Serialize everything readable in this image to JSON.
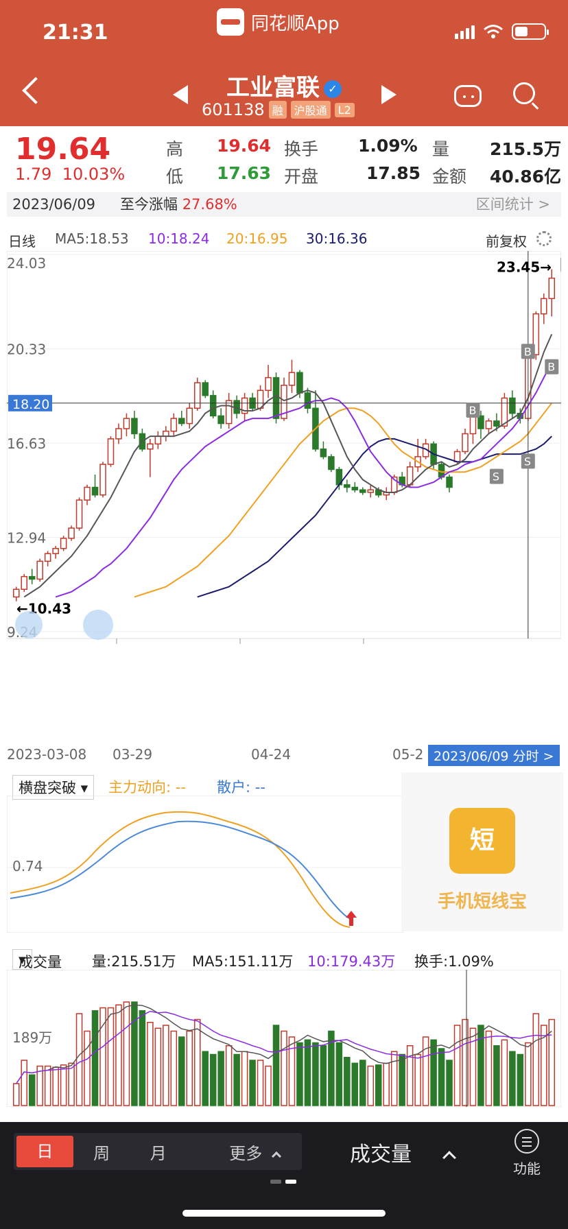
{
  "status_bar": {
    "time": "21:31",
    "app_name": "同花顺App"
  },
  "header": {
    "stock_name": "工业富联",
    "stock_code": "601138",
    "tags": [
      "融",
      "沪股通",
      "L2"
    ],
    "icons": [
      "back-icon",
      "prev-stock-icon",
      "next-stock-icon",
      "robot-icon",
      "search-icon",
      "verified-icon"
    ]
  },
  "quote": {
    "price": "19.64",
    "change": "1.79",
    "change_pct": "10.03%",
    "high_label": "高",
    "high": "19.64",
    "low_label": "低",
    "low": "17.63",
    "turnover_label": "换手",
    "turnover": "1.09%",
    "open_label": "开盘",
    "open": "17.85",
    "volume_label": "量",
    "volume": "215.5万",
    "amount_label": "金额",
    "amount": "40.86亿"
  },
  "date_bar": {
    "date": "2023/06/09",
    "gain_label": "至今涨幅",
    "gain": "27.68%",
    "stats": "区间统计 >"
  },
  "ma_row": {
    "period": "日线",
    "ma5": "MA5:18.53",
    "ma10": "10:18.24",
    "ma20": "20:16.95",
    "ma30": "30:16.36",
    "adjust": "前复权"
  },
  "kline": {
    "y_ticks": [
      "24.03",
      "20.33",
      "16.63",
      "12.94",
      "9.24"
    ],
    "crosshair_price": "18.20",
    "max_label": "23.45→",
    "min_label": "←10.43",
    "x_ticks": [
      "2023-03-08",
      "03-29",
      "04-24",
      "05-2"
    ],
    "crosshair_date": "2023/06/09 分时 >"
  },
  "panel2": {
    "indicator": "横盘突破",
    "main_force": "主力动向: --",
    "retail": "散户: --",
    "y_tick": "0.74",
    "promo_icon_text": "短",
    "promo_text": "手机短线宝"
  },
  "panel3": {
    "indicator": "成交量",
    "volume": "量:215.51万",
    "ma5": "MA5:151.11万",
    "ma10": "10:179.43万",
    "turnover": "换手:1.09%",
    "y_tick": "189万"
  },
  "bottom_bar": {
    "tabs": [
      "日",
      "周",
      "月",
      "更多"
    ],
    "indicator_select": "成交量",
    "func_label": "功能"
  },
  "colors": {
    "brand": "#d0543a",
    "up": "#e02e2e",
    "down": "#2d9b37",
    "ma5": "#555555",
    "ma10": "#8a2be2",
    "ma20": "#f0a020",
    "ma30": "#1a1a6e",
    "crosshair": "#3a78d6"
  },
  "chart_data": {
    "type": "candlestick",
    "price_axis": [
      24.03,
      20.33,
      16.63,
      12.94,
      9.24
    ],
    "ohlc": [
      [
        10.6,
        11.0,
        10.43,
        10.9
      ],
      [
        10.9,
        11.5,
        10.8,
        11.4
      ],
      [
        11.4,
        11.7,
        11.1,
        11.3
      ],
      [
        11.3,
        12.1,
        11.2,
        12.0
      ],
      [
        12.0,
        12.4,
        11.8,
        12.3
      ],
      [
        12.3,
        12.6,
        12.1,
        12.5
      ],
      [
        12.5,
        13.0,
        12.4,
        12.9
      ],
      [
        12.9,
        13.4,
        12.8,
        13.3
      ],
      [
        13.3,
        14.5,
        13.2,
        14.4
      ],
      [
        14.4,
        15.0,
        14.2,
        14.9
      ],
      [
        14.9,
        15.4,
        14.5,
        14.6
      ],
      [
        14.6,
        15.9,
        14.5,
        15.8
      ],
      [
        15.8,
        16.9,
        15.7,
        16.8
      ],
      [
        16.8,
        17.4,
        16.6,
        17.2
      ],
      [
        17.2,
        17.8,
        16.9,
        17.6
      ],
      [
        17.6,
        17.9,
        16.8,
        17.0
      ],
      [
        17.0,
        17.2,
        16.3,
        16.4
      ],
      [
        16.4,
        16.8,
        15.3,
        16.6
      ],
      [
        16.6,
        17.1,
        16.4,
        16.9
      ],
      [
        16.9,
        17.3,
        16.7,
        17.1
      ],
      [
        17.1,
        17.8,
        16.9,
        17.6
      ],
      [
        17.6,
        17.9,
        17.3,
        17.4
      ],
      [
        17.4,
        18.2,
        17.2,
        18.0
      ],
      [
        18.0,
        19.2,
        17.9,
        19.0
      ],
      [
        19.0,
        19.1,
        18.4,
        18.5
      ],
      [
        18.5,
        18.7,
        17.6,
        17.7
      ],
      [
        17.7,
        18.0,
        17.2,
        17.4
      ],
      [
        17.4,
        18.6,
        17.2,
        18.3
      ],
      [
        18.3,
        18.5,
        17.6,
        17.8
      ],
      [
        17.8,
        18.6,
        17.5,
        18.4
      ],
      [
        18.4,
        18.6,
        17.9,
        18.0
      ],
      [
        18.0,
        18.9,
        17.9,
        18.7
      ],
      [
        18.7,
        19.7,
        18.4,
        19.2
      ],
      [
        19.2,
        19.4,
        17.4,
        17.6
      ],
      [
        17.6,
        19.2,
        17.5,
        18.9
      ],
      [
        18.9,
        19.9,
        18.6,
        19.4
      ],
      [
        19.4,
        19.5,
        18.4,
        18.6
      ],
      [
        18.6,
        18.8,
        17.8,
        18.0
      ],
      [
        18.0,
        18.7,
        16.3,
        16.4
      ],
      [
        16.4,
        16.7,
        16.0,
        16.1
      ],
      [
        16.1,
        16.2,
        15.5,
        15.6
      ],
      [
        15.6,
        15.7,
        14.8,
        15.0
      ],
      [
        15.0,
        15.2,
        14.7,
        14.9
      ],
      [
        14.9,
        15.1,
        14.7,
        14.8
      ],
      [
        14.8,
        14.9,
        14.6,
        14.7
      ],
      [
        14.7,
        15.0,
        14.5,
        14.8
      ],
      [
        14.8,
        14.9,
        14.5,
        14.6
      ],
      [
        14.6,
        14.9,
        14.4,
        14.7
      ],
      [
        14.7,
        15.4,
        14.6,
        15.3
      ],
      [
        15.3,
        15.5,
        14.9,
        15.0
      ],
      [
        15.0,
        15.9,
        14.9,
        15.7
      ],
      [
        15.7,
        16.8,
        15.5,
        16.1
      ],
      [
        16.1,
        16.8,
        16.0,
        16.6
      ],
      [
        16.6,
        16.7,
        15.6,
        15.8
      ],
      [
        15.8,
        15.9,
        15.2,
        15.3
      ],
      [
        15.3,
        15.4,
        14.7,
        14.9
      ],
      [
        15.9,
        16.4,
        15.8,
        16.3
      ],
      [
        16.3,
        17.2,
        16.2,
        17.0
      ],
      [
        17.0,
        17.8,
        16.6,
        17.7
      ],
      [
        17.7,
        17.9,
        16.8,
        17.2
      ],
      [
        17.2,
        17.6,
        17.0,
        17.5
      ],
      [
        17.5,
        17.8,
        17.1,
        17.3
      ],
      [
        17.3,
        18.6,
        17.2,
        18.4
      ],
      [
        18.4,
        18.7,
        17.6,
        17.8
      ],
      [
        17.8,
        18.0,
        17.4,
        17.6
      ],
      [
        17.6,
        20.3,
        17.5,
        20.1
      ],
      [
        20.1,
        21.8,
        19.9,
        21.7
      ],
      [
        21.7,
        22.5,
        21.3,
        22.3
      ],
      [
        22.3,
        23.45,
        21.6,
        23.1
      ]
    ],
    "ma5": [
      10.6,
      10.8,
      11.0,
      11.3,
      11.6,
      11.9,
      12.2,
      12.6,
      13.0,
      13.5,
      14.0,
      14.5,
      15.1,
      15.7,
      16.3,
      16.7,
      16.9,
      16.9,
      16.9,
      16.9,
      17.0,
      17.1,
      17.4,
      17.8,
      18.0,
      18.1,
      18.1,
      18.0,
      17.9,
      17.9,
      18.0,
      18.3,
      18.5,
      18.3,
      18.4,
      18.6,
      18.7,
      18.6,
      18.2,
      17.5,
      16.8,
      16.1,
      15.6,
      15.2,
      15.0,
      14.8,
      14.7,
      14.7,
      14.8,
      15.0,
      15.3,
      15.6,
      15.8,
      15.9,
      15.7,
      15.8,
      16.0,
      16.4,
      16.7,
      17.0,
      17.2,
      17.4,
      17.6,
      17.8,
      18.4,
      19.3,
      20.2,
      20.9
    ],
    "ma10": [
      10.6,
      10.7,
      10.8,
      11.0,
      11.2,
      11.4,
      11.7,
      11.9,
      12.2,
      12.5,
      12.9,
      13.3,
      13.7,
      14.2,
      14.7,
      15.2,
      15.6,
      15.9,
      16.2,
      16.5,
      16.7,
      16.9,
      17.1,
      17.3,
      17.5,
      17.6,
      17.6,
      17.6,
      17.7,
      17.8,
      17.9,
      18.0,
      18.2,
      18.3,
      18.3,
      18.4,
      18.3,
      18.0,
      17.5,
      16.9,
      16.3,
      15.9,
      15.5,
      15.2,
      15.0,
      14.9,
      14.9,
      15.0,
      15.1,
      15.3,
      15.5,
      15.6,
      15.8,
      15.9,
      16.0,
      16.3,
      16.6,
      16.9,
      17.2,
      17.6,
      18.1,
      18.6,
      19.2,
      19.8
    ],
    "ma20": [
      10.6,
      10.7,
      10.8,
      10.9,
      11.0,
      11.2,
      11.4,
      11.6,
      11.8,
      12.1,
      12.4,
      12.7,
      13.0,
      13.4,
      13.8,
      14.2,
      14.6,
      15.0,
      15.4,
      15.8,
      16.2,
      16.6,
      16.9,
      17.2,
      17.5,
      17.7,
      17.9,
      18.0,
      18.0,
      17.9,
      17.7,
      17.4,
      17.0,
      16.6,
      16.3,
      16.1,
      15.9,
      15.7,
      15.6,
      15.5,
      15.5,
      15.5,
      15.5,
      15.6,
      15.7,
      15.9,
      16.1,
      16.3,
      16.5,
      16.7,
      17.0,
      17.4,
      17.8,
      18.2
    ],
    "ma30": [
      10.6,
      10.7,
      10.8,
      10.9,
      11.0,
      11.2,
      11.4,
      11.6,
      11.8,
      12.0,
      12.3,
      12.6,
      12.9,
      13.2,
      13.5,
      13.8,
      14.2,
      14.6,
      15.0,
      15.4,
      15.8,
      16.2,
      16.5,
      16.7,
      16.8,
      16.8,
      16.7,
      16.6,
      16.5,
      16.4,
      16.2,
      16.1,
      16.0,
      15.9,
      15.9,
      15.9,
      16.0,
      16.1,
      16.2,
      16.2,
      16.2,
      16.2,
      16.3,
      16.4,
      16.6,
      16.9
    ]
  }
}
